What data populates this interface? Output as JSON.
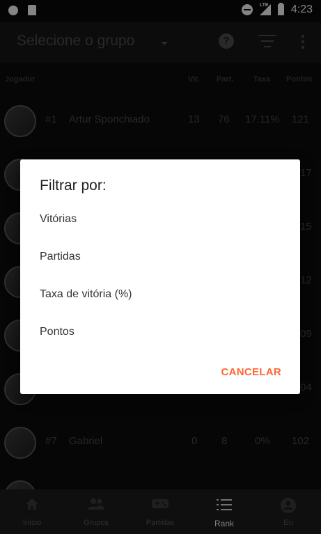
{
  "status_bar": {
    "time": "4:23",
    "network": "LTE"
  },
  "app_bar": {
    "title": "Selecione o grupo",
    "help_symbol": "?"
  },
  "table": {
    "headers": {
      "player": "Jogador",
      "wins": "Vit.",
      "matches": "Part.",
      "rate": "Taxa",
      "points": "Pontos"
    },
    "rows": [
      {
        "rank": "#1",
        "name": "Artur Sponchiado",
        "wins": "13",
        "matches": "76",
        "rate": "17.11%",
        "points": "121"
      },
      {
        "points": "17"
      },
      {
        "points": "15"
      },
      {
        "points": "12"
      },
      {
        "points": "09"
      },
      {
        "points": "04"
      },
      {
        "rank": "#7",
        "name": "Gabriel",
        "wins": "0",
        "matches": "8",
        "rate": "0%",
        "points": "102"
      }
    ]
  },
  "dialog": {
    "title": "Filtrar por:",
    "options": [
      "Vitórias",
      "Partidas",
      "Taxa de vitória (%)",
      "Pontos"
    ],
    "cancel_label": "CANCELAR",
    "accent_color": "#ff6633"
  },
  "bottom_nav": {
    "items": [
      {
        "label": "Início",
        "icon": "home-icon"
      },
      {
        "label": "Grupos",
        "icon": "group-icon"
      },
      {
        "label": "Partidas",
        "icon": "gamepad-icon"
      },
      {
        "label": "Rank",
        "icon": "rank-list-icon"
      },
      {
        "label": "Eu",
        "icon": "account-icon"
      }
    ],
    "active": "Rank"
  }
}
